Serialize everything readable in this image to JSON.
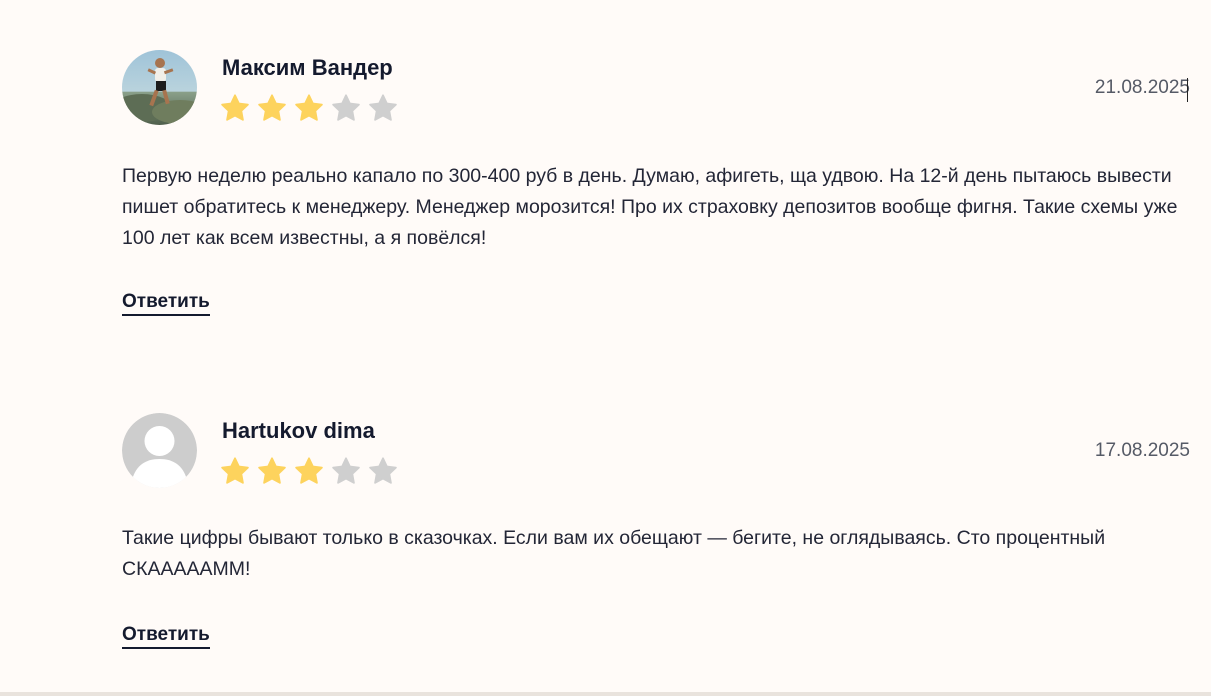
{
  "colors": {
    "star_filled": "#fdd35d",
    "star_empty": "#cfcfcf",
    "background": "#fffbf8"
  },
  "reviews": [
    {
      "author": "Максим Вандер",
      "rating": 3,
      "max_rating": 5,
      "date": "21.08.2025",
      "text": "Первую неделю реально капало по 300-400 руб в день. Думаю, афигеть, ща удвою. На 12-й день пытаюсь вывести пишет обратитесь к менеджеру. Менеджер морозится! Про их страховку депозитов вообще фигня. Такие схемы уже 100 лет как всем известны, а я повёлся!",
      "reply_label": "Ответить",
      "avatar": "user-photo"
    },
    {
      "author": "Hartukov dima",
      "rating": 3,
      "max_rating": 5,
      "date": "17.08.2025",
      "text": "Такие цифры бывают только в сказочках. Если вам их обещают — бегите, не оглядываясь. Сто процентный СКАААААММ!",
      "reply_label": "Ответить",
      "avatar": "default-user-icon"
    }
  ]
}
